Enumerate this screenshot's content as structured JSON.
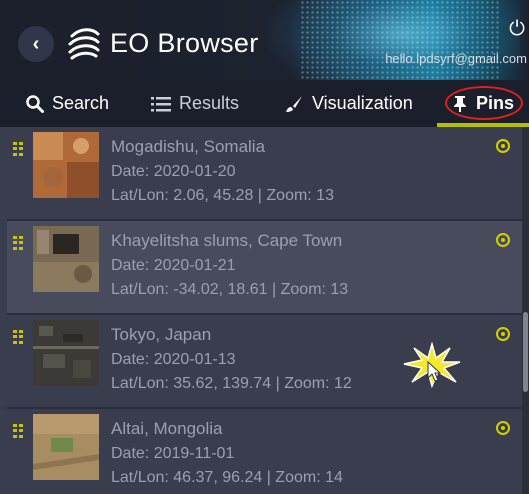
{
  "header": {
    "app_title": "EO Browser",
    "user_email": "hello.lpdsyrf@gmail.com",
    "back_icon": "chevron-left-icon",
    "logo_icon": "eo-browser-logo",
    "power_icon": "power-icon"
  },
  "tabs": [
    {
      "label": "Search",
      "icon": "search-icon"
    },
    {
      "label": "Results",
      "icon": "list-icon"
    },
    {
      "label": "Visualization",
      "icon": "brush-icon"
    },
    {
      "label": "Pins",
      "icon": "pin-icon",
      "active": true
    }
  ],
  "pins": [
    {
      "title": "Mogadishu, Somalia",
      "date": "Date: 2020-01-20",
      "meta": "Lat/Lon: 2.06, 45.28 | Zoom: 13"
    },
    {
      "title": "Khayelitsha slums, Cape Town",
      "date": "Date: 2020-01-21",
      "meta": "Lat/Lon: -34.02, 18.61 | Zoom: 13"
    },
    {
      "title": "Tokyo, Japan",
      "date": "Date: 2020-01-13",
      "meta": "Lat/Lon: 35.62, 139.74 | Zoom: 12"
    },
    {
      "title": "Altai, Mongolia",
      "date": "Date: 2019-11-01",
      "meta": "Lat/Lon: 46.37, 96.24 | Zoom: 14"
    }
  ],
  "colors": {
    "accent": "#b6bf00",
    "highlight_circle": "#e0201b",
    "panel_bg": "#3a3d4d",
    "header_bg": "#1b1f2b"
  }
}
